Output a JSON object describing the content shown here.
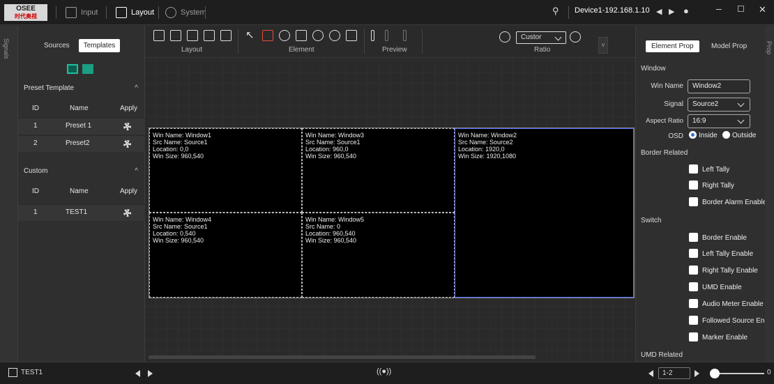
{
  "app": {
    "logo_line1": "OSEE",
    "logo_line2": "时代奥视",
    "menu": [
      {
        "label": "Input",
        "icon": "input-icon",
        "active": false
      },
      {
        "label": "Layout",
        "icon": "layout-icon",
        "active": true
      },
      {
        "label": "System",
        "icon": "system-icon",
        "active": false
      }
    ],
    "device": "Device1-192.168.1.10"
  },
  "left_panel": {
    "side_tab": "Signals",
    "tabs": [
      "Sources",
      "Templates"
    ],
    "active_tab": "Templates",
    "preset_section": {
      "title": "Preset Template",
      "columns": [
        "ID",
        "Name",
        "Apply"
      ],
      "rows": [
        {
          "id": "1",
          "name": "Preset 1"
        },
        {
          "id": "2",
          "name": "Preset2"
        }
      ]
    },
    "custom_section": {
      "title": "Custom",
      "columns": [
        "ID",
        "Name",
        "Apply"
      ],
      "rows": [
        {
          "id": "1",
          "name": "TEST1"
        }
      ]
    }
  },
  "toolbar": {
    "groups": [
      "Layout",
      "Element",
      "Preview",
      "Ratio"
    ],
    "ratio_value": "Custor"
  },
  "windows": [
    {
      "win_name": "Win Name: Window1",
      "src_name": "Src Name: Source1",
      "location": "Location: 0,0",
      "win_size": "Win Size: 960,540"
    },
    {
      "win_name": "Win Name: Window3",
      "src_name": "Src Name: Source1",
      "location": "Location: 960,0",
      "win_size": "Win Size: 960,540"
    },
    {
      "win_name": "Win Name: Window2",
      "src_name": "Src Name: Source2",
      "location": "Location: 1920,0",
      "win_size": "Win Size: 1920,1080"
    },
    {
      "win_name": "Win Name: Window4",
      "src_name": "Src Name: Source1",
      "location": "Location: 0,540",
      "win_size": "Win Size: 960,540"
    },
    {
      "win_name": "Win Name: Window5",
      "src_name": "Src Name: 0",
      "location": "Location: 960,540",
      "win_size": "Win Size: 960,540"
    }
  ],
  "right_panel": {
    "side_tab": "Prop",
    "tabs": [
      "Element Prop",
      "Model Prop"
    ],
    "active_tab": "Element Prop",
    "window_section": "Window",
    "win_name_label": "Win Name",
    "win_name_value": "Window2",
    "signal_label": "Signal",
    "signal_value": "Source2",
    "aspect_label": "Aspect Ratio",
    "aspect_value": "16:9",
    "osd_label": "OSD",
    "osd_options": [
      "Inside",
      "Outside"
    ],
    "osd_selected": "Inside",
    "border_section": "Border Related",
    "border_checks": [
      "Left Tally",
      "Right Tally",
      "Border Alarm Enable"
    ],
    "switch_section": "Switch",
    "switch_checks": [
      "Border Enable",
      "Left Tally Enable",
      "Right Tally Enable",
      "UMD Enable",
      "Audio Meter Enable",
      "Followed Source Enal",
      "Marker Enable"
    ],
    "umd_section": "UMD Related"
  },
  "status": {
    "current_template": "TEST1",
    "page": "1-2",
    "zoom": "0",
    "broadcast_icon": "((●))"
  }
}
